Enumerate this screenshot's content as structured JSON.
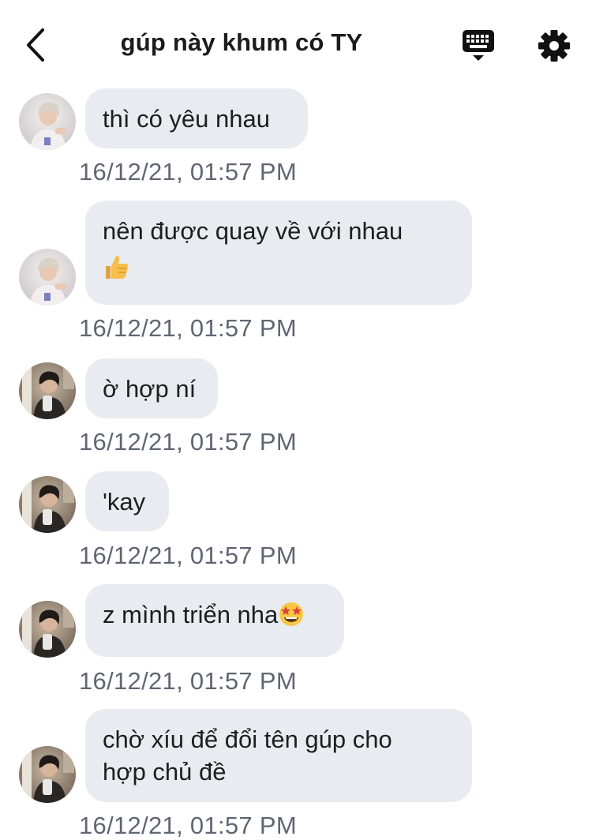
{
  "header": {
    "title": "gúp này khum có TY",
    "back_icon": "chevron-left-icon",
    "keyboard_icon": "keyboard-icon",
    "settings_icon": "gear-icon"
  },
  "colors": {
    "bubble": "#e8ebf0",
    "timestamp": "#5f6673",
    "text": "#1e1e1e"
  },
  "messages": [
    {
      "sender": "user-a",
      "text": "thì có yêu nhau",
      "time": "16/12/21, 01:57 PM"
    },
    {
      "sender": "user-a",
      "text": "nên được quay về với nhau",
      "emoji": "thumbs-up",
      "time": "16/12/21, 01:57 PM"
    },
    {
      "sender": "user-b",
      "text": "ờ hợp ní",
      "time": "16/12/21, 01:57 PM"
    },
    {
      "sender": "user-b",
      "text": "'kay",
      "time": "16/12/21, 01:57 PM"
    },
    {
      "sender": "user-b",
      "text": "z mình triển nha",
      "emoji": "star-struck",
      "time": "16/12/21, 01:57 PM"
    },
    {
      "sender": "user-b",
      "text_line1": "chờ xíu để đổi tên gúp cho",
      "text_line2": "hợp chủ đề",
      "time": "16/12/21, 01:57 PM"
    }
  ]
}
